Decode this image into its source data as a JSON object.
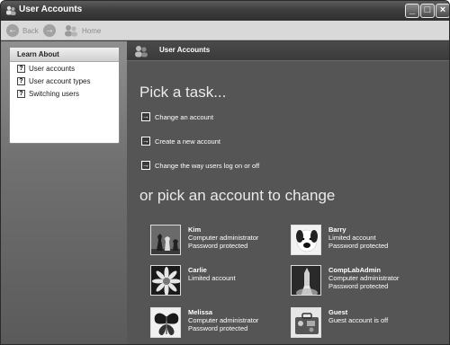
{
  "window": {
    "title": "User Accounts",
    "min": "_",
    "max": "□",
    "close": "×"
  },
  "toolbar": {
    "back_label": "Back",
    "home_label": "Home"
  },
  "learn_about": {
    "heading": "Learn About",
    "links": [
      "User accounts",
      "User account types",
      "Switching users"
    ]
  },
  "main": {
    "header": "User Accounts",
    "pick_task": "Pick a task...",
    "tasks": [
      "Change an account",
      "Create a new account",
      "Change the way users log on or off"
    ],
    "pick_account": "or pick an account to change",
    "accounts": [
      {
        "name": "Kim",
        "line1": "Computer administrator",
        "line2": "Password protected",
        "picture": "chess-picture"
      },
      {
        "name": "Barry",
        "line1": "Limited account",
        "line2": "Password protected",
        "picture": "dog-picture"
      },
      {
        "name": "Carlie",
        "line1": "Limited account",
        "line2": "",
        "picture": "flower-picture"
      },
      {
        "name": "CompLabAdmin",
        "line1": "Computer administrator",
        "line2": "Password protected",
        "picture": "rocket-picture"
      },
      {
        "name": "Melissa",
        "line1": "Computer administrator",
        "line2": "Password protected",
        "picture": "butterfly-picture"
      },
      {
        "name": "Guest",
        "line1": "Guest account is off",
        "line2": "",
        "picture": "suitcase-picture"
      }
    ]
  }
}
